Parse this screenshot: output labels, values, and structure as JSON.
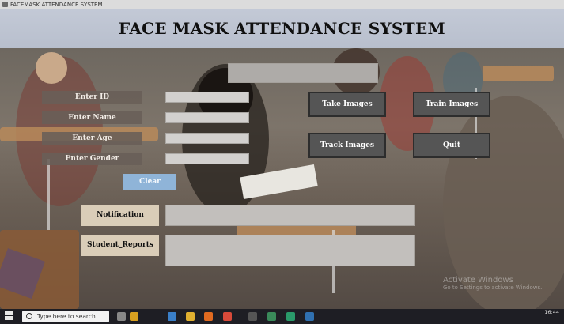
{
  "window": {
    "title": "FACEMASK ATTENDANCE SYSTEM"
  },
  "header": {
    "title": "FACE MASK ATTENDANCE SYSTEM"
  },
  "form": {
    "enter_id_label": "Enter ID",
    "enter_name_label": "Enter Name",
    "enter_age_label": "Enter Age",
    "enter_gender_label": "Enter Gender",
    "id_value": "",
    "name_value": "",
    "age_value": "",
    "gender_value": "",
    "clear_label": "Clear"
  },
  "actions": {
    "take_images": "Take Images",
    "train_images": "Train Images",
    "track_images": "Track Images",
    "quit": "Quit"
  },
  "output": {
    "notification_label": "Notification",
    "student_reports_label": "Student_Reports",
    "notification_text": "",
    "student_reports_text": ""
  },
  "watermark": {
    "line1": "Activate Windows",
    "line2": "Go to Settings to activate Windows."
  },
  "taskbar": {
    "search_placeholder": "Type here to search",
    "clock": "16:44"
  },
  "colors": {
    "clear_button": "#8fb4d8",
    "action_button": "#555555",
    "header_bg": "#c3c9d6"
  }
}
